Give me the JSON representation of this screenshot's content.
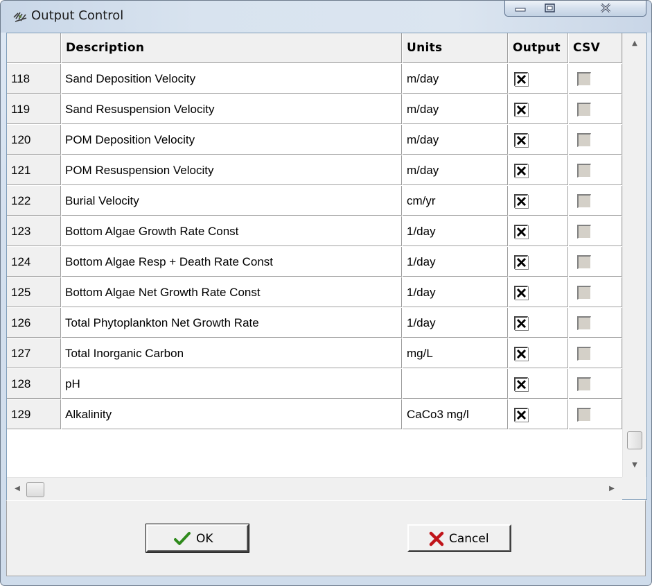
{
  "window": {
    "title": "Output Control"
  },
  "grid": {
    "columns": [
      "",
      "Description",
      "Units",
      "Output",
      "CSV"
    ],
    "rows": [
      {
        "num": "118",
        "description": "Sand Deposition Velocity",
        "units": "m/day",
        "output": true,
        "csv": false
      },
      {
        "num": "119",
        "description": "Sand Resuspension Velocity",
        "units": "m/day",
        "output": true,
        "csv": false
      },
      {
        "num": "120",
        "description": "POM Deposition Velocity",
        "units": "m/day",
        "output": true,
        "csv": false
      },
      {
        "num": "121",
        "description": "POM Resuspension Velocity",
        "units": "m/day",
        "output": true,
        "csv": false
      },
      {
        "num": "122",
        "description": "Burial Velocity",
        "units": "cm/yr",
        "output": true,
        "csv": false
      },
      {
        "num": "123",
        "description": "Bottom Algae Growth Rate Const",
        "units": "1/day",
        "output": true,
        "csv": false
      },
      {
        "num": "124",
        "description": "Bottom Algae Resp + Death Rate Const",
        "units": "1/day",
        "output": true,
        "csv": false
      },
      {
        "num": "125",
        "description": "Bottom Algae Net Growth Rate Const",
        "units": "1/day",
        "output": true,
        "csv": false
      },
      {
        "num": "126",
        "description": "Total Phytoplankton Net Growth Rate",
        "units": "1/day",
        "output": true,
        "csv": false
      },
      {
        "num": "127",
        "description": "Total Inorganic Carbon",
        "units": "mg/L",
        "output": true,
        "csv": false
      },
      {
        "num": "128",
        "description": "pH",
        "units": "",
        "output": true,
        "csv": false
      },
      {
        "num": "129",
        "description": "Alkalinity",
        "units": "CaCo3 mg/l",
        "output": true,
        "csv": false
      }
    ]
  },
  "buttons": {
    "ok_label": "OK",
    "cancel_label": "Cancel"
  },
  "colors": {
    "ok_check": "#2f8a1c",
    "cancel_x": "#c0141a"
  }
}
